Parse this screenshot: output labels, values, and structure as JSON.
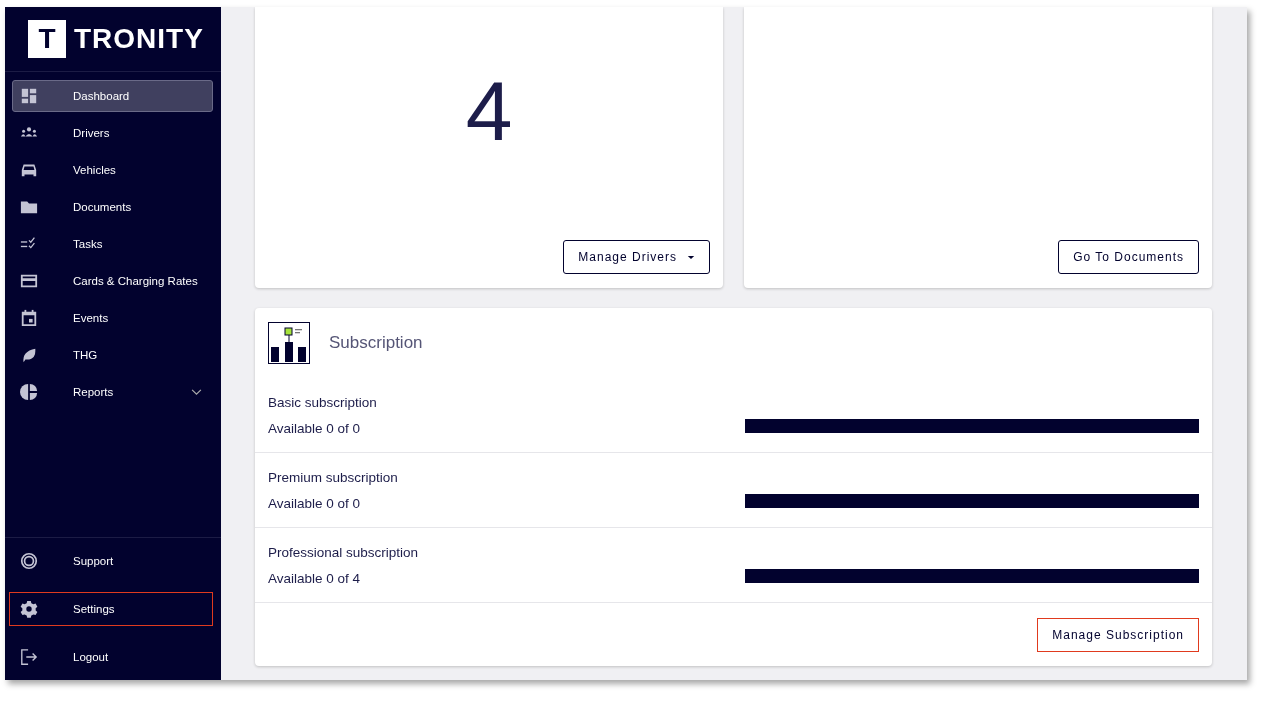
{
  "sidebar": {
    "logo": {
      "mark": "T",
      "name": "TRONITY"
    },
    "items": [
      {
        "label": "Dashboard",
        "kind": "dashboard",
        "selected": true
      },
      {
        "label": "Drivers",
        "kind": "people",
        "selected": false
      },
      {
        "label": "Vehicles",
        "kind": "car",
        "selected": false
      },
      {
        "label": "Documents",
        "kind": "folder",
        "selected": false
      },
      {
        "label": "Tasks",
        "kind": "tasks",
        "selected": false
      },
      {
        "label": "Cards & Charging Rates",
        "kind": "card",
        "selected": false
      },
      {
        "label": "Events",
        "kind": "calendar",
        "selected": false
      },
      {
        "label": "THG",
        "kind": "leaf",
        "selected": false
      },
      {
        "label": "Reports",
        "kind": "pie",
        "selected": false,
        "expandable": true
      }
    ],
    "bottom_items": [
      {
        "label": "Support",
        "kind": "lifebuoy",
        "highlighted": false
      },
      {
        "label": "Settings",
        "kind": "gear",
        "highlighted": true
      },
      {
        "label": "Logout",
        "kind": "logout",
        "highlighted": false
      }
    ]
  },
  "cards": [
    {
      "value": "4",
      "button": {
        "label": "Manage Drivers",
        "dropdown": true
      }
    },
    {
      "button": {
        "label": "Go To Documents",
        "dropdown": false
      }
    }
  ],
  "subscription": {
    "title": "Subscription",
    "rows": [
      {
        "name": "Basic subscription",
        "available": "Available 0 of 0",
        "level": 1
      },
      {
        "name": "Premium subscription",
        "available": "Available 0 of 0",
        "level": 1
      },
      {
        "name": "Professional subscription",
        "available": "Available 0 of 4",
        "level": 1
      }
    ],
    "button": {
      "label": "Manage Subscription",
      "highlighted": true
    }
  }
}
